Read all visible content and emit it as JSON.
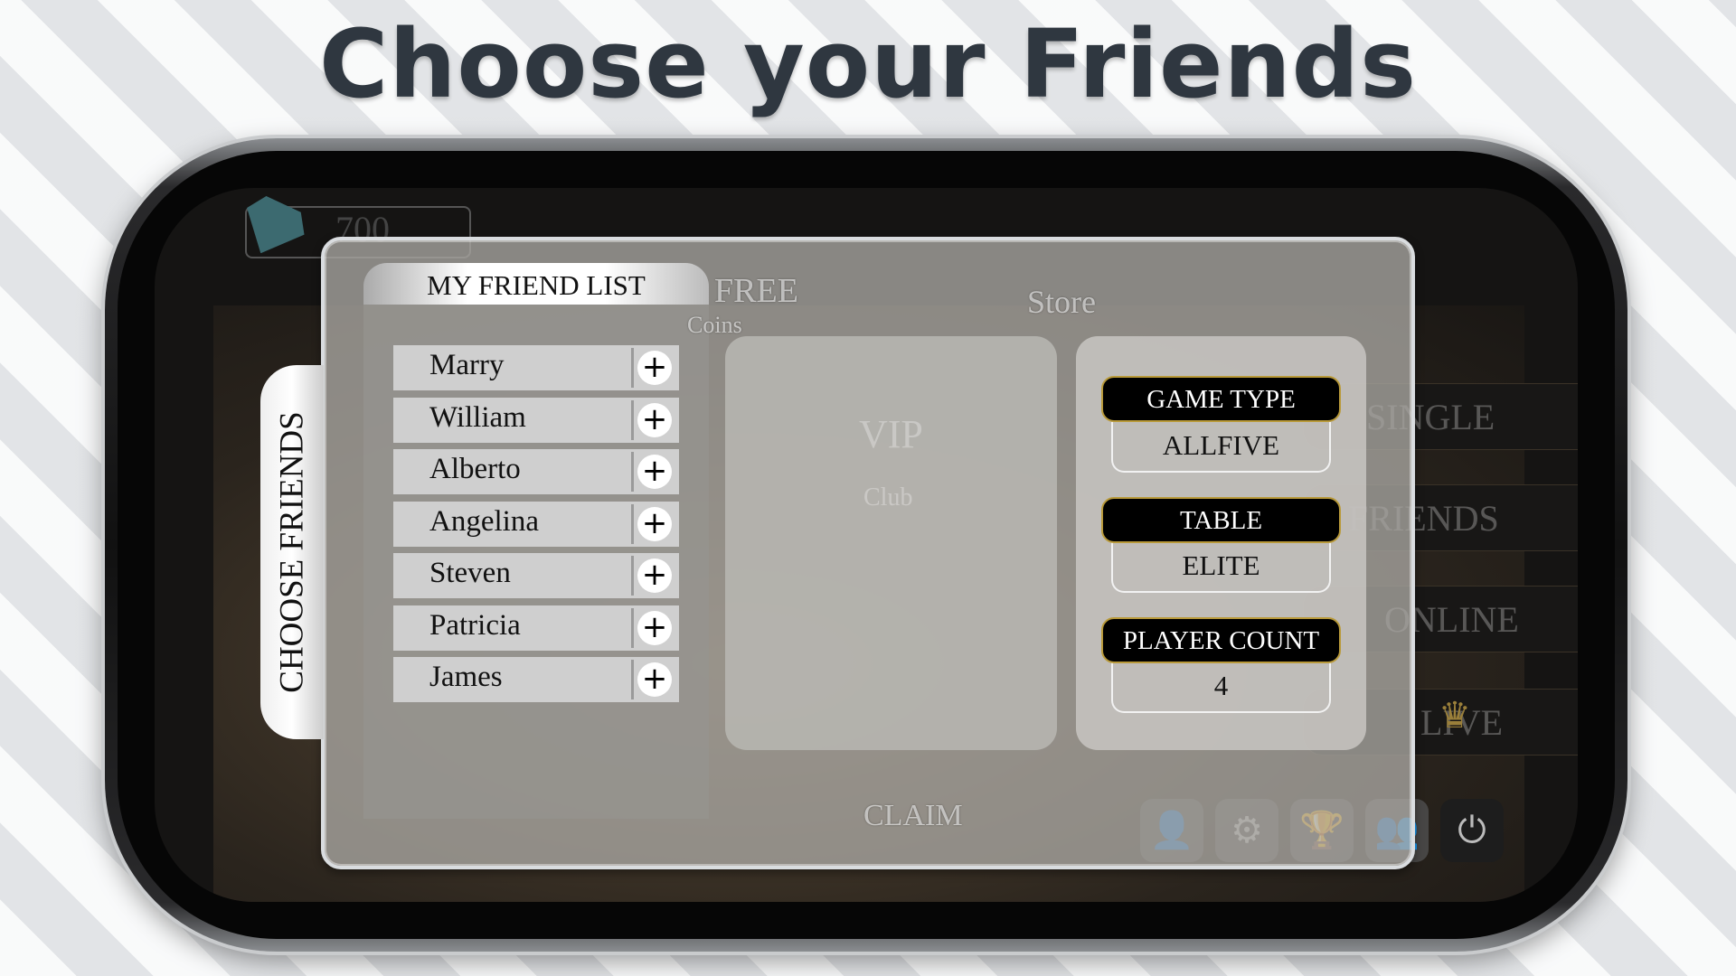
{
  "headline": "Choose your Friends",
  "background": {
    "coins": "700",
    "free": "FREE",
    "coins_label": "Coins",
    "store": "Store",
    "vip": "VIP",
    "club": "Club",
    "claim": "CLAIM",
    "menu": [
      "SINGLE",
      "FRIENDS",
      "ONLINE",
      "LIVE"
    ]
  },
  "side_tab": "CHOOSE FRIENDS",
  "friend_list": {
    "title": "MY FRIEND LIST",
    "add_icon": "plus-icon",
    "friends": [
      "Marry",
      "William",
      "Alberto",
      "Angelina",
      "Steven",
      "Patricia",
      "James"
    ]
  },
  "settings": {
    "game_type": {
      "label": "GAME TYPE",
      "value": "ALLFIVE"
    },
    "table": {
      "label": "TABLE",
      "value": "ELITE"
    },
    "player_count": {
      "label": "PLAYER COUNT",
      "value": "4"
    }
  },
  "colors": {
    "pill_border": "#b99a3a",
    "pill_bg": "#000000"
  }
}
